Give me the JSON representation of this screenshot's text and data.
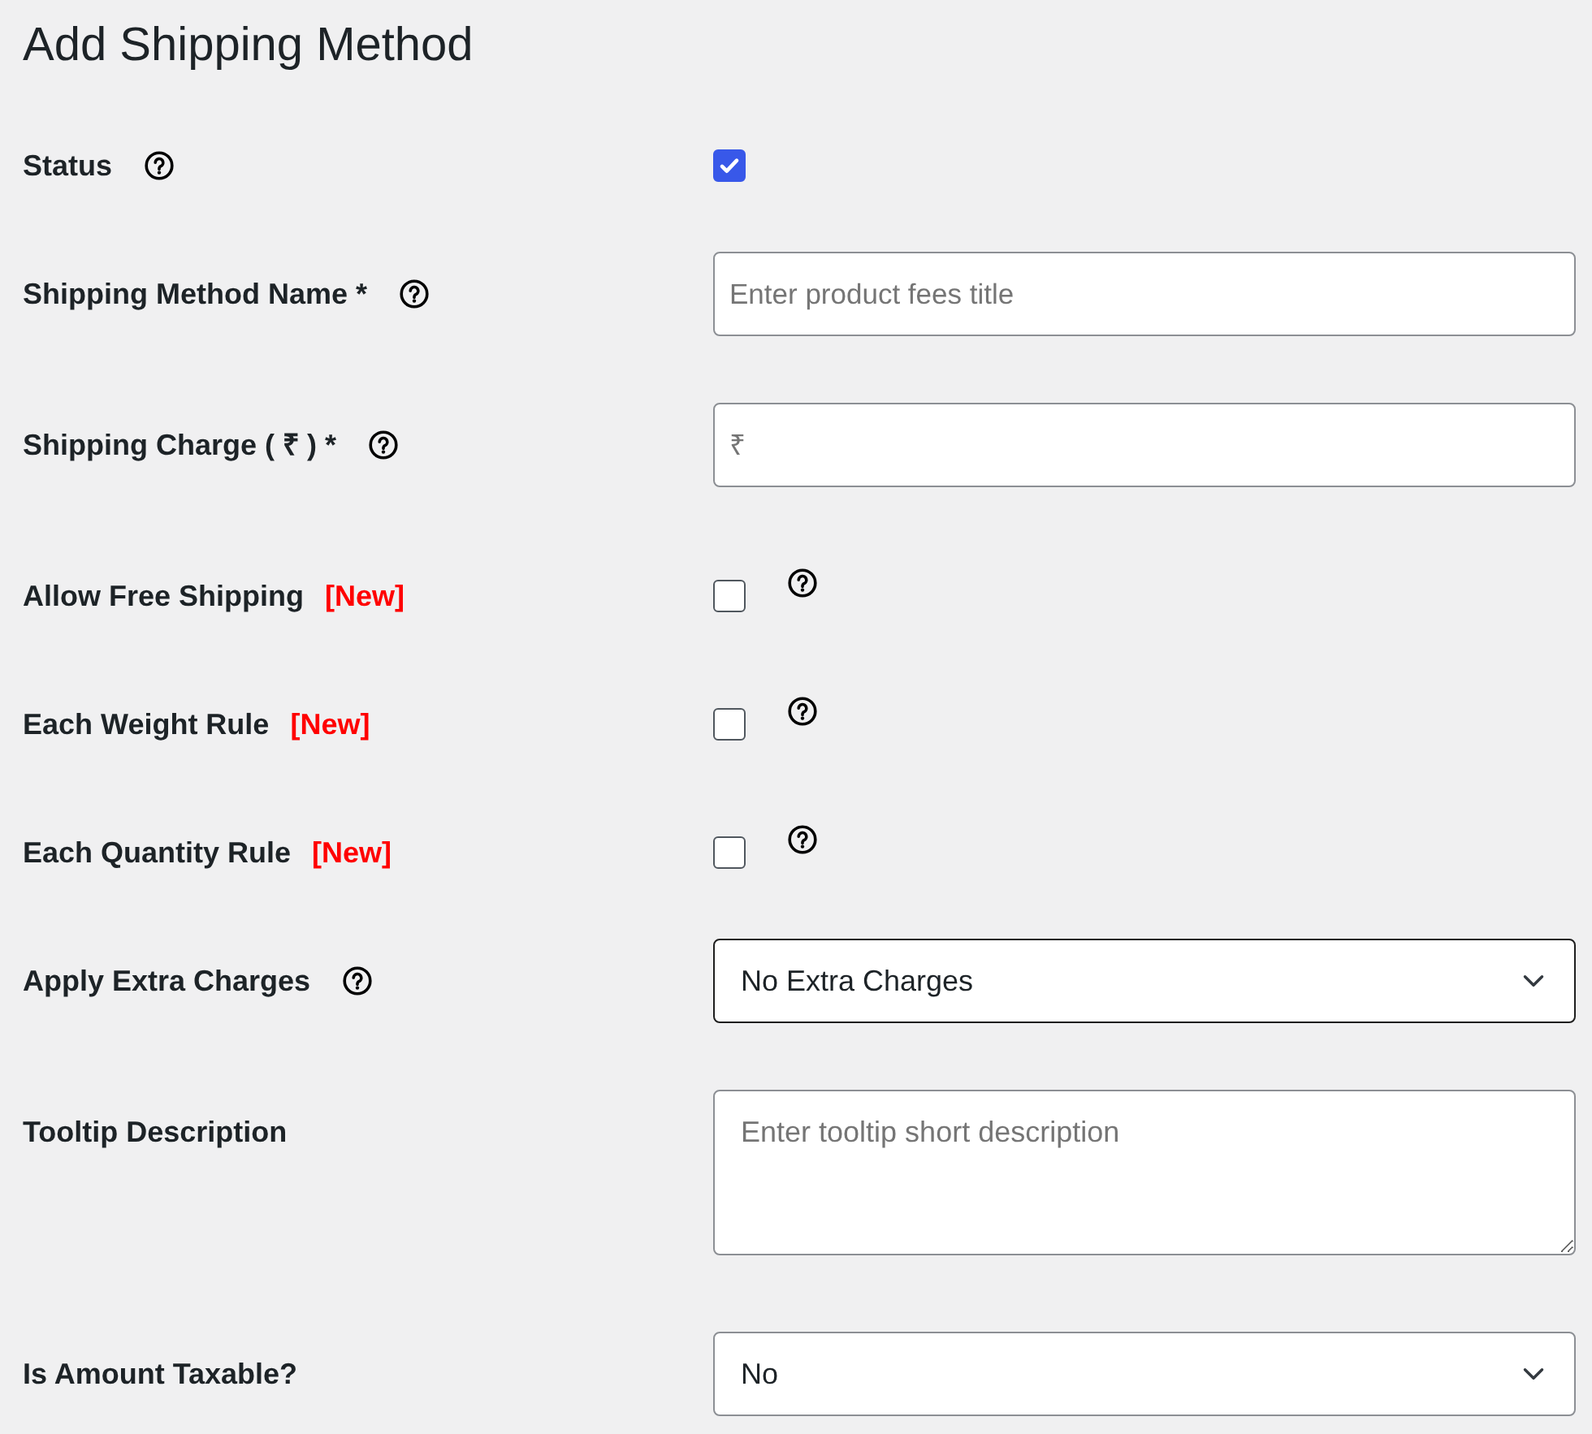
{
  "page": {
    "title": "Add Shipping Method"
  },
  "rows": [
    {
      "label": "Status",
      "kind": "checkbox",
      "checked": true,
      "help_beside_label": true,
      "help_beside_control": false
    },
    {
      "label": "Shipping Method Name *",
      "kind": "text",
      "placeholder": "Enter product fees title",
      "help_beside_label": true,
      "help_beside_control": false
    },
    {
      "label": "Shipping Charge ( ₹ ) *",
      "kind": "text",
      "placeholder": "₹",
      "help_beside_label": true,
      "help_beside_control": false
    },
    {
      "label": "Allow Free Shipping",
      "tag": "[New]",
      "kind": "checkbox",
      "checked": false,
      "help_beside_label": false,
      "help_beside_control": true
    },
    {
      "label": "Each Weight Rule",
      "tag": "[New]",
      "kind": "checkbox",
      "checked": false,
      "help_beside_label": false,
      "help_beside_control": true
    },
    {
      "label": "Each Quantity Rule",
      "tag": "[New]",
      "kind": "checkbox",
      "checked": false,
      "help_beside_label": false,
      "help_beside_control": true
    },
    {
      "label": "Apply Extra Charges",
      "kind": "select",
      "value": "No Extra Charges",
      "focused": true,
      "help_beside_label": true,
      "help_beside_control": false
    },
    {
      "label": "Tooltip Description",
      "kind": "textarea",
      "placeholder": "Enter tooltip short description",
      "help_beside_label": false,
      "help_beside_control": false
    },
    {
      "label": "Is Amount Taxable?",
      "kind": "select",
      "value": "No",
      "focused": false,
      "help_beside_label": false,
      "help_beside_control": false
    }
  ]
}
